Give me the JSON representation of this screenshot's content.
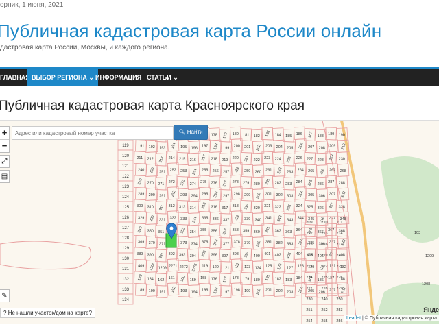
{
  "header": {
    "date": "орник, 1 июня, 2021",
    "title": "Публичная кадастровая карта России онлайн",
    "subtitle": "дастровая карта России, Москвы, и каждого региона."
  },
  "nav": {
    "items": [
      {
        "label": "ГЛАВНАЯ"
      },
      {
        "label": "ВЫБОР РЕГИОНА ⌄"
      },
      {
        "label": "ИНФОРМАЦИЯ"
      },
      {
        "label": "СТАТЬИ ⌄"
      }
    ]
  },
  "page": {
    "title": "Публичная кадастровая карта Красноярского края"
  },
  "map": {
    "search_placeholder": "Адрес или кадастровый номер участка",
    "search_button": "Найти",
    "zoom_in": "+",
    "zoom_out": "−",
    "not_found": "Не нашли участок/дом на карте?",
    "attribution_leaflet": "Leaflet",
    "attribution_rest": " | © Публичная кадастровая карта",
    "yandex": "Янде",
    "colors": {
      "parcel_line": "#e8a0a0",
      "parcel_text": "#333333",
      "selected_parcel": "#4cd04c",
      "marker": "#2f7fd0",
      "green_area": "#c7e3c0",
      "road": "#f2c77a"
    },
    "parcel_labels": [
      "119",
      "120",
      "121",
      "122",
      "123",
      "124",
      "125",
      "126",
      "127",
      "128",
      "129",
      "130",
      "131",
      "132",
      "133",
      "134",
      "162",
      "161",
      "160",
      "159",
      "158",
      "176",
      "177",
      "178",
      "179",
      "180",
      "181",
      "182",
      "183",
      "184",
      "185",
      "186",
      "187",
      "188",
      "189",
      "190",
      "191",
      "192",
      "193",
      "194",
      "195",
      "196",
      "197",
      "198",
      "199",
      "200",
      "201",
      "202",
      "203",
      "204",
      "205",
      "206",
      "207",
      "208",
      "209",
      "210",
      "211",
      "212",
      "213",
      "214",
      "215",
      "216",
      "217",
      "218",
      "219",
      "220",
      "221",
      "222",
      "223",
      "224",
      "225",
      "226",
      "227",
      "228",
      "229",
      "230",
      "240",
      "250",
      "251",
      "252",
      "253",
      "254",
      "255",
      "256",
      "257",
      "258",
      "259",
      "260",
      "261",
      "262",
      "263",
      "264",
      "265",
      "266",
      "267",
      "268",
      "269",
      "270",
      "271",
      "272",
      "273",
      "274",
      "275",
      "276",
      "277",
      "278",
      "279",
      "280",
      "281",
      "282",
      "283",
      "284",
      "285",
      "286",
      "287",
      "288",
      "289",
      "290",
      "291",
      "292",
      "293",
      "294",
      "295",
      "296",
      "297",
      "298",
      "299",
      "300",
      "301",
      "302",
      "303",
      "304",
      "305",
      "306",
      "307",
      "308",
      "309",
      "310",
      "311",
      "312",
      "313",
      "314",
      "315",
      "316",
      "317",
      "318",
      "319",
      "320",
      "321",
      "322",
      "323",
      "324",
      "325",
      "326",
      "327",
      "328",
      "329",
      "330",
      "331",
      "332",
      "333",
      "334",
      "335",
      "336",
      "337",
      "338",
      "339",
      "340",
      "341",
      "342",
      "343",
      "344",
      "345",
      "346",
      "347",
      "348",
      "349",
      "350",
      "351",
      "352",
      "353",
      "354",
      "355",
      "356",
      "357",
      "358",
      "359",
      "360",
      "361",
      "362",
      "363",
      "364",
      "365",
      "366",
      "367",
      "368",
      "369",
      "370",
      "371",
      "372",
      "373",
      "374",
      "375",
      "376",
      "377",
      "378",
      "379",
      "380",
      "381",
      "382",
      "383",
      "384",
      "385",
      "386",
      "387",
      "388",
      "389",
      "390",
      "391",
      "392",
      "393",
      "394",
      "395",
      "396",
      "397",
      "398",
      "399",
      "400",
      "401",
      "402",
      "403",
      "404",
      "405",
      "406",
      "407",
      "408",
      "409",
      "1208",
      "1209",
      "2271",
      "2272",
      "2273"
    ]
  }
}
